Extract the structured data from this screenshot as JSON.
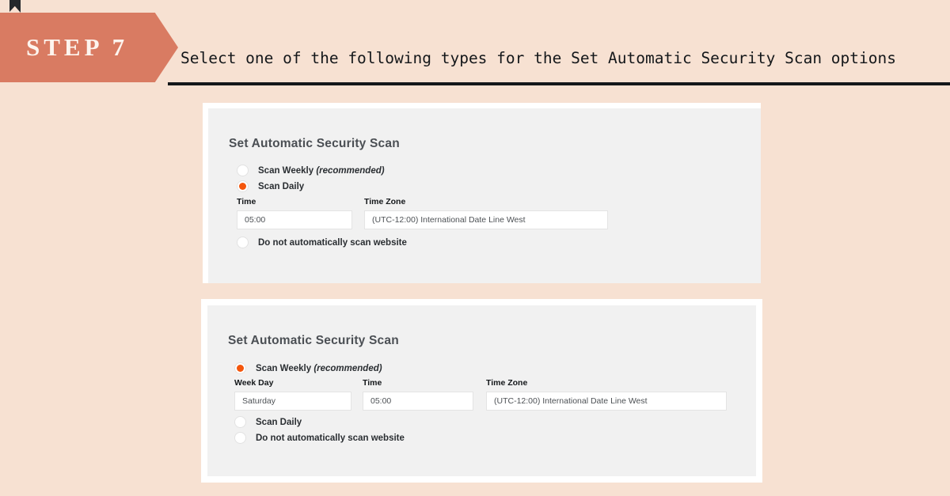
{
  "step": {
    "badge_label": "STEP 7",
    "instruction": "Select one of the following types for the Set Automatic Security Scan options"
  },
  "theme": {
    "page_background": "#f7e1d2",
    "banner_color": "#d97b62",
    "banner_fold_color": "#24282c",
    "rule_color": "#14171a",
    "panel_border_color": "#ffffff",
    "panel_background": "#f1f1f1",
    "radio_selected_color": "#f4560c",
    "input_background": "#ffffff",
    "input_border_color": "#e4e4e4",
    "title_color": "#4b4f54"
  },
  "panels": [
    {
      "id": "daily-selected",
      "title": "Set Automatic Security Scan",
      "options": [
        {
          "label": "Scan Weekly",
          "emphasis": "(recommended)",
          "selected": false
        },
        {
          "label": "Scan Daily",
          "emphasis": "",
          "selected": true
        },
        {
          "label": "Do not automatically scan website",
          "emphasis": "",
          "selected": false
        }
      ],
      "fields": [
        {
          "label": "Time",
          "value": "05:00"
        },
        {
          "label": "Time Zone",
          "value": "(UTC-12:00) International Date Line West"
        }
      ]
    },
    {
      "id": "weekly-selected",
      "title": "Set Automatic Security Scan",
      "options": [
        {
          "label": "Scan Weekly",
          "emphasis": "(recommended)",
          "selected": true
        },
        {
          "label": "Scan Daily",
          "emphasis": "",
          "selected": false
        },
        {
          "label": "Do not automatically scan website",
          "emphasis": "",
          "selected": false
        }
      ],
      "fields": [
        {
          "label": "Week Day",
          "value": "Saturday"
        },
        {
          "label": "Time",
          "value": "05:00"
        },
        {
          "label": "Time Zone",
          "value": "(UTC-12:00) International Date Line West"
        }
      ]
    }
  ]
}
